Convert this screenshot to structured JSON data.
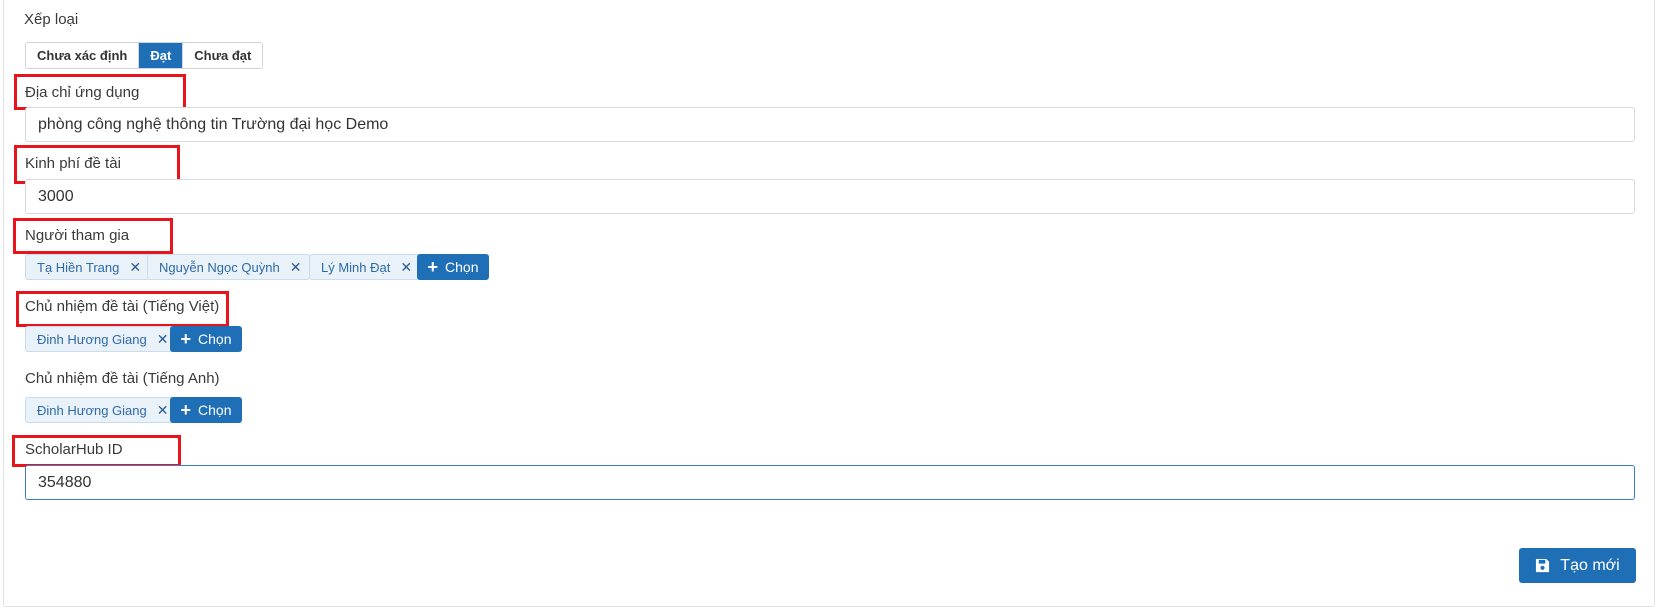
{
  "classification": {
    "label": "Xếp loại",
    "options": [
      "Chưa xác định",
      "Đạt",
      "Chưa đạt"
    ],
    "selected": "Đạt"
  },
  "application_address": {
    "label": "Địa chỉ ứng dụng",
    "value": "phòng công nghệ thông tin Trường đại học Demo"
  },
  "budget": {
    "label": "Kinh phí đề tài",
    "value": "3000"
  },
  "participants": {
    "label": "Người tham gia",
    "items": [
      "Tạ Hiền Trang",
      "Nguyễn Ngọc Quỳnh",
      "Lý Minh Đạt"
    ],
    "choose_label": "Chọn"
  },
  "leader_vi": {
    "label": "Chủ nhiệm đề tài (Tiếng Việt)",
    "items": [
      "Đinh Hương Giang"
    ],
    "choose_label": "Chọn"
  },
  "leader_en": {
    "label": "Chủ nhiệm đề tài (Tiếng Anh)",
    "items": [
      "Đinh Hương Giang"
    ],
    "choose_label": "Chọn"
  },
  "scholarhub": {
    "label": "ScholarHub ID",
    "value": "354880"
  },
  "submit": {
    "label": "Tạo mới",
    "icon": "save-icon"
  },
  "colors": {
    "primary": "#1f6fb6",
    "highlight": "#e8141b",
    "tag_bg": "#e9f1f9"
  }
}
